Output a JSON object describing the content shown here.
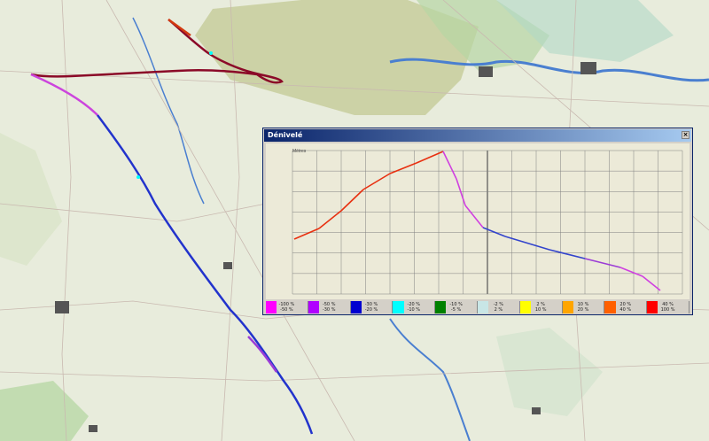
{
  "window": {
    "title": "Dénivelé",
    "close_glyph": "×"
  },
  "chart": {
    "type": "line",
    "ylabel": "Mètres"
  },
  "legend": [
    {
      "top": "-100 %",
      "bottom": "-50 %",
      "color": "#ff00ff"
    },
    {
      "top": "-50 %",
      "bottom": "-30 %",
      "color": "#b000ff"
    },
    {
      "top": "-30 %",
      "bottom": "-20 %",
      "color": "#0000d0"
    },
    {
      "top": "-20 %",
      "bottom": "-10 %",
      "color": "#00ffff"
    },
    {
      "top": "-10 %",
      "bottom": "-5 %",
      "color": "#008000"
    },
    {
      "top": "-2 %",
      "bottom": "2 %",
      "color": "#c8e6e6"
    },
    {
      "top": "2 %",
      "bottom": "10 %",
      "color": "#ffff00"
    },
    {
      "top": "10 %",
      "bottom": "20 %",
      "color": "#ffa500"
    },
    {
      "top": "20 %",
      "bottom": "40 %",
      "color": "#ff6000"
    },
    {
      "top": "40 %",
      "bottom": "100 %",
      "color": "#ff0000"
    }
  ],
  "colors": {
    "route_primary": "#2233cc",
    "route_climb": "#9b0a2a",
    "route_descent": "#cc44dd",
    "profile_climb": "#e83010",
    "profile_descent": "#d040e0",
    "profile_flat": "#3344cc",
    "grid": "#808080",
    "plot_bg": "#ecead8"
  }
}
